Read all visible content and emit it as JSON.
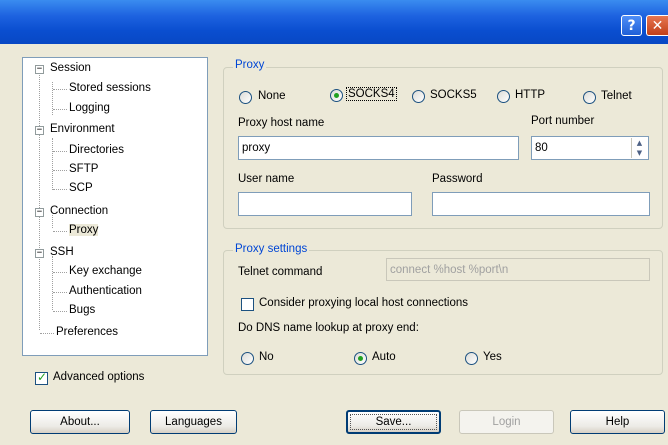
{
  "titlebar": {
    "help_glyph": "?",
    "close_glyph": "✕"
  },
  "tree": {
    "items": [
      {
        "label": "Session",
        "level": 0
      },
      {
        "label": "Stored sessions",
        "level": 1
      },
      {
        "label": "Logging",
        "level": 1
      },
      {
        "label": "Environment",
        "level": 0
      },
      {
        "label": "Directories",
        "level": 1
      },
      {
        "label": "SFTP",
        "level": 1
      },
      {
        "label": "SCP",
        "level": 1
      },
      {
        "label": "Connection",
        "level": 0
      },
      {
        "label": "Proxy",
        "level": 1,
        "selected": true
      },
      {
        "label": "SSH",
        "level": 0
      },
      {
        "label": "Key exchange",
        "level": 1
      },
      {
        "label": "Authentication",
        "level": 1
      },
      {
        "label": "Bugs",
        "level": 1
      },
      {
        "label": "Preferences",
        "level": 0
      }
    ]
  },
  "advanced": {
    "label": "Advanced options",
    "checked": true
  },
  "proxy": {
    "group_title": "Proxy",
    "types": [
      "None",
      "SOCKS4",
      "SOCKS5",
      "HTTP",
      "Telnet"
    ],
    "selected_type": "SOCKS4",
    "host_label": "Proxy host name",
    "host_value": "proxy",
    "port_label": "Port number",
    "port_value": "80",
    "user_label": "User name",
    "user_value": "",
    "password_label": "Password",
    "password_value": ""
  },
  "settings": {
    "group_title": "Proxy settings",
    "telnet_label": "Telnet command",
    "telnet_value": "connect %host %port\\n",
    "local_label": "Consider proxying local host connections",
    "local_checked": false,
    "dns_label": "Do DNS name lookup at proxy end:",
    "dns_options": [
      "No",
      "Auto",
      "Yes"
    ],
    "dns_selected": "Auto"
  },
  "buttons": {
    "about": "About...",
    "languages": "Languages",
    "save": "Save...",
    "login": "Login",
    "help": "Help"
  },
  "colors": {
    "titlebar": "#0a4ed0",
    "group_title": "#0046d5",
    "dialog_bg": "#ece9d8"
  }
}
